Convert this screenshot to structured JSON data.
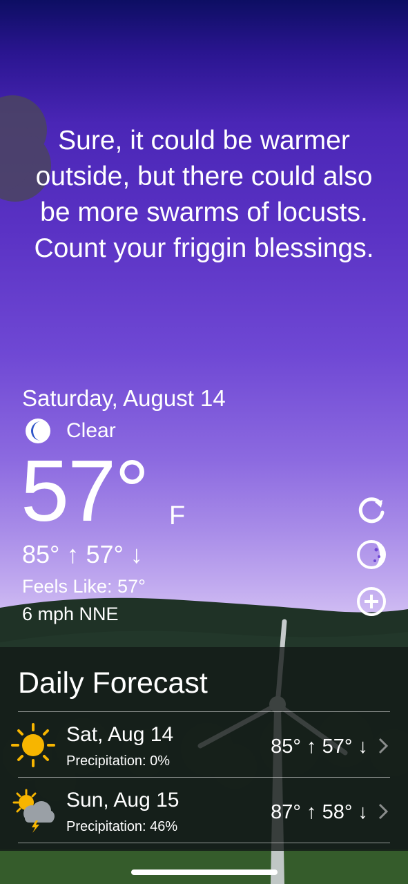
{
  "quote": "Sure, it could be warmer outside, but there could also be more swarms of locusts. Count your friggin blessings.",
  "current": {
    "date": "Saturday, August 14",
    "condition": "Clear",
    "condition_icon": "moon-icon",
    "temperature": "57°",
    "unit": "F",
    "hi_lo": "85° ↑  57° ↓",
    "feels_like": "Feels Like: 57°",
    "wind": "6 mph NNE"
  },
  "controls": {
    "refresh_icon": "refresh-icon",
    "theme_icon": "theme-icon",
    "add_icon": "add-location-icon"
  },
  "forecast": {
    "title": "Daily Forecast",
    "days": [
      {
        "day": "Sat, Aug 14",
        "precipitation": "Precipitation: 0%",
        "temps": "85° ↑  57° ↓",
        "icon": "sun-icon"
      },
      {
        "day": "Sun, Aug 15",
        "precipitation": "Precipitation: 46%",
        "temps": "87° ↑  58° ↓",
        "icon": "partly-cloudy-storm-icon"
      }
    ]
  },
  "colors": {
    "sky_top": "#0d0e63",
    "sky_mid": "#5a32c4",
    "sky_bottom": "#d2bff3",
    "sun": "#f7b500"
  }
}
